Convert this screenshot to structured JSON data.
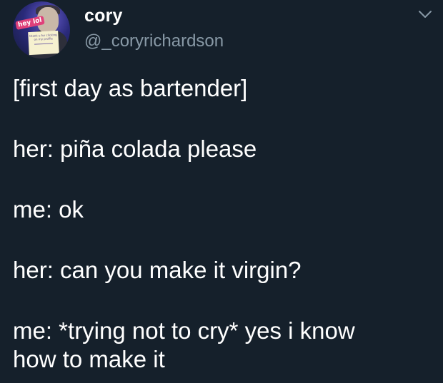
{
  "user": {
    "display_name": "cory",
    "handle": "@_coryrichardson",
    "avatar_sticker": "hey lol",
    "avatar_note": "thank u for clicking on my profile"
  },
  "menu": {
    "icon": "chevron-down-icon"
  },
  "tweet": {
    "lines": [
      "[first day as bartender]",
      "her: piña colada please",
      "me: ok",
      "her: can you make it virgin?",
      "me: *trying not to cry* yes i know",
      "how to make it"
    ]
  },
  "colors": {
    "background": "#15202b",
    "text": "#ffffff",
    "secondary_text": "#8899a6"
  }
}
